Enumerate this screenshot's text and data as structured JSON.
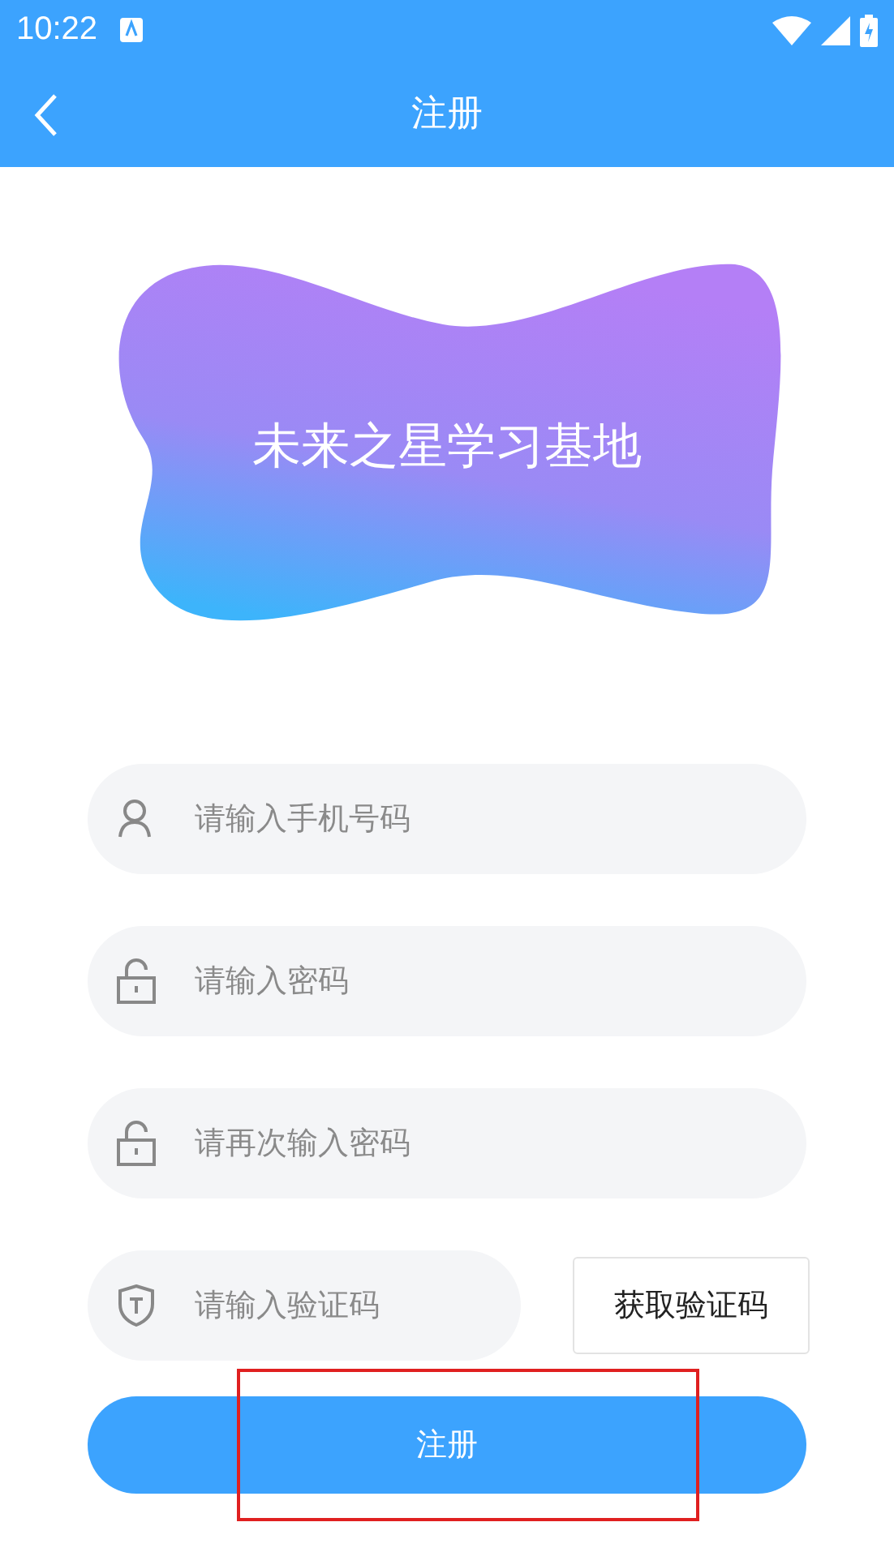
{
  "status_bar": {
    "time": "10:22"
  },
  "app_bar": {
    "title": "注册"
  },
  "banner": {
    "title": "未来之星学习基地"
  },
  "fields": [
    {
      "kind": "phone",
      "placeholder": "请输入手机号码"
    },
    {
      "kind": "password",
      "placeholder": "请输入密码"
    },
    {
      "kind": "password",
      "placeholder": "请再次输入密码"
    },
    {
      "kind": "code",
      "placeholder": "请输入验证码",
      "button": "获取验证码"
    }
  ],
  "submit": {
    "label": "注册",
    "highlighted": true
  }
}
